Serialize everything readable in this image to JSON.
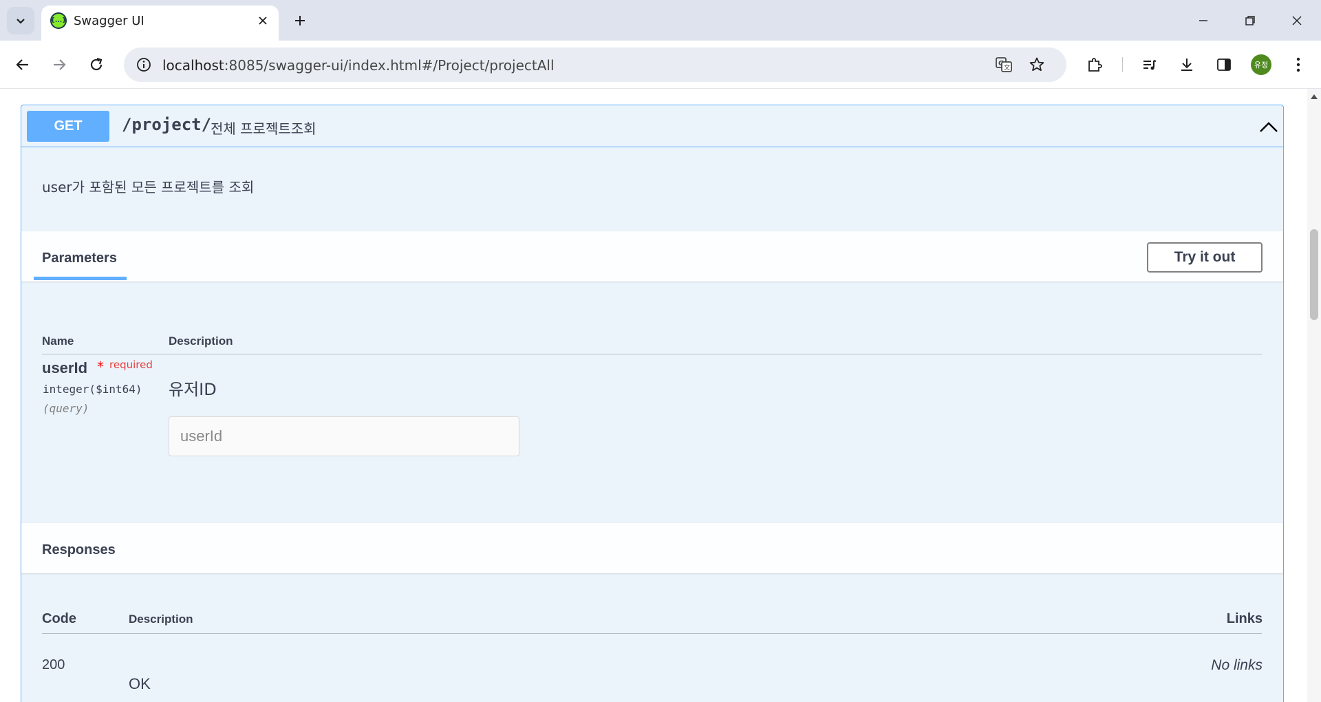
{
  "browser": {
    "tab_title": "Swagger UI",
    "url_host": "localhost",
    "url_rest": ":8085/swagger-ui/index.html#/Project/projectAll",
    "profile_initials": "유정",
    "favicon_glyph": "{...}"
  },
  "operation": {
    "method": "GET",
    "path": "/project/",
    "summary": "전체 프로젝트조회",
    "description": "user가 포함된 모든 프로젝트를 조회",
    "method_color": "#61affe"
  },
  "parameters": {
    "tab_label": "Parameters",
    "try_button": "Try it out",
    "col_name": "Name",
    "col_description": "Description",
    "items": [
      {
        "name": "userId",
        "required_star": "*",
        "required_label": "required",
        "type": "integer($int64)",
        "in": "(query)",
        "description": "유저ID",
        "placeholder": "userId"
      }
    ]
  },
  "responses": {
    "title": "Responses",
    "col_code": "Code",
    "col_description": "Description",
    "col_links": "Links",
    "items": [
      {
        "code": "200",
        "description": "OK",
        "links": "No links"
      }
    ]
  }
}
